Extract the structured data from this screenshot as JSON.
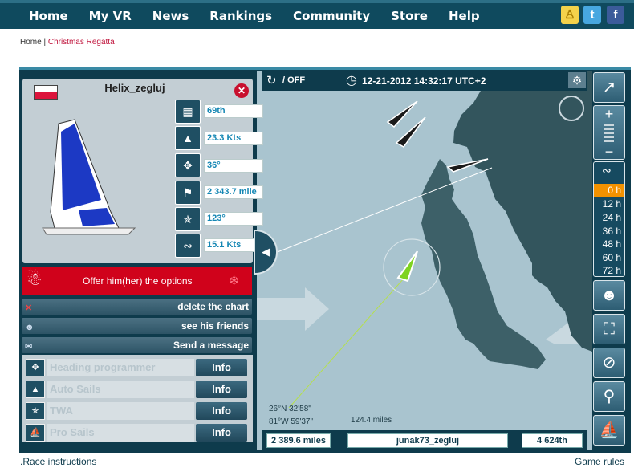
{
  "nav": {
    "items": [
      "Home",
      "My VR",
      "News",
      "Rankings",
      "Community",
      "Store",
      "Help"
    ]
  },
  "breadcrumb": {
    "home": "Home",
    "sep": " | ",
    "current": "Christmas Regatta"
  },
  "map_top": {
    "autorefresh": "/ OFF",
    "datetime": "12-21-2012 14:32:17 UTC+2"
  },
  "player": {
    "name": "Helix_zegluj",
    "rank": "69th",
    "speed": "23.3 Kts",
    "heading": "36°",
    "distance": "2 343.7 mile",
    "twa": "123°",
    "wind": "15.1 Kts"
  },
  "offer": "Offer him(her) the options",
  "actions": {
    "delete_chart": "delete the chart",
    "see_friends": "see his friends",
    "send_message": "Send a message"
  },
  "options": [
    {
      "label": "Heading programmer",
      "button": "Info"
    },
    {
      "label": "Auto Sails",
      "button": "Info"
    },
    {
      "label": "TWA",
      "button": "Info"
    },
    {
      "label": "Pro Sails",
      "button": "Info"
    }
  ],
  "coords": {
    "lat": "26°N 32'58\"",
    "lon": "81°W 59'37\"",
    "measure": "124.4 miles"
  },
  "bottom": {
    "distance": "2 389.6 miles",
    "player": "junak73_zegluj",
    "rank": "4 624th"
  },
  "hours": [
    "0 h",
    "12 h",
    "24 h",
    "36 h",
    "48 h",
    "60 h",
    "72 h"
  ],
  "footer": {
    "left": ".Race instructions",
    "right": "Game rules"
  },
  "colors": {
    "nav_bg": "#0f4a5e",
    "accent": "#1587b4",
    "offer_red": "#d0021b",
    "selected_hour": "#f39200",
    "boat_green": "#7ed321"
  }
}
